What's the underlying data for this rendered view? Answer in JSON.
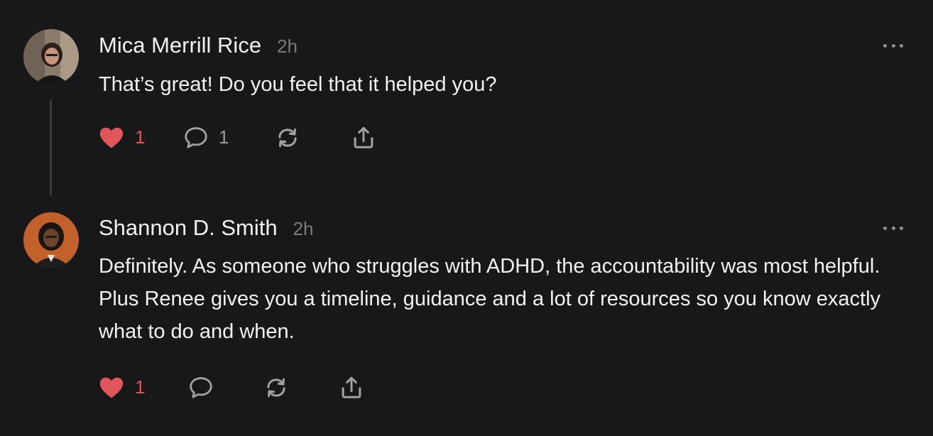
{
  "posts": [
    {
      "author": "Mica Merrill Rice",
      "time": "2h",
      "text": "That’s great! Do you feel that it helped you?",
      "likes": "1",
      "replies": "1",
      "liked": true
    },
    {
      "author": "Shannon D. Smith",
      "time": "2h",
      "text": "Definitely. As someone who struggles with ADHD, the accountability was most helpful. Plus Renee gives you a timeline, guidance and a lot of resources so you know exactly what to do and when.",
      "likes": "1",
      "replies": "",
      "liked": true
    }
  ],
  "colors": {
    "background": "#18181a",
    "text": "#f2f2f2",
    "muted": "#7b7b80",
    "like": "#e0565b",
    "icon": "#a1a1a6"
  },
  "icons": [
    "heart-icon",
    "comment-icon",
    "repost-icon",
    "share-icon",
    "more-icon"
  ]
}
